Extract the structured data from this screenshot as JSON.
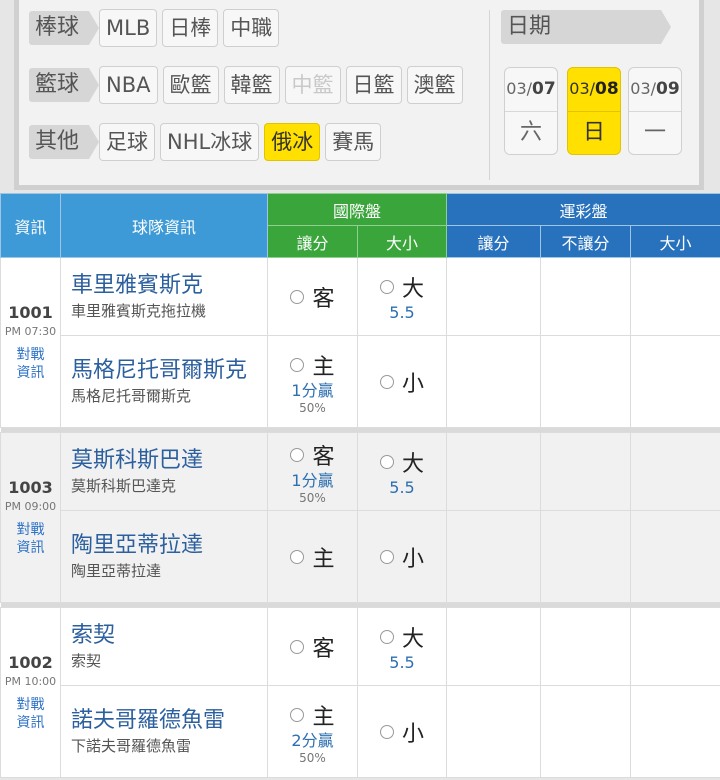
{
  "filters": [
    {
      "label": "棒球",
      "chips": [
        {
          "text": "MLB",
          "state": "normal"
        },
        {
          "text": "日棒",
          "state": "normal"
        },
        {
          "text": "中職",
          "state": "normal"
        }
      ]
    },
    {
      "label": "籃球",
      "chips": [
        {
          "text": "NBA",
          "state": "normal"
        },
        {
          "text": "歐籃",
          "state": "normal"
        },
        {
          "text": "韓籃",
          "state": "normal"
        },
        {
          "text": "中籃",
          "state": "disabled"
        },
        {
          "text": "日籃",
          "state": "normal"
        },
        {
          "text": "澳籃",
          "state": "normal"
        }
      ]
    },
    {
      "label": "其他",
      "chips": [
        {
          "text": "足球",
          "state": "normal"
        },
        {
          "text": "NHL冰球",
          "state": "normal"
        },
        {
          "text": "俄冰",
          "state": "active"
        },
        {
          "text": "賽馬",
          "state": "normal"
        }
      ]
    }
  ],
  "date": {
    "label": "日期",
    "items": [
      {
        "month": "03/",
        "day": "07",
        "weekday": "六",
        "active": false
      },
      {
        "month": "03/",
        "day": "08",
        "weekday": "日",
        "active": true
      },
      {
        "month": "03/",
        "day": "09",
        "weekday": "一",
        "active": false
      }
    ]
  },
  "table": {
    "headers": {
      "info": "資訊",
      "team": "球隊資訊",
      "intl": "國際盤",
      "intl_spread": "讓分",
      "intl_total": "大小",
      "lottery": "運彩盤",
      "lot_spread": "讓分",
      "lot_nospread": "不讓分",
      "lot_total": "大小"
    },
    "games": [
      {
        "no": "1001",
        "time": "PM 07:30",
        "link": [
          "對戰",
          "資訊"
        ],
        "home": {
          "name": "車里雅賓斯克",
          "sub": "車里雅賓斯克拖拉機",
          "spread": "客",
          "spread_line": "",
          "spread_pct": "",
          "total": "大",
          "total_line": "5.5"
        },
        "away": {
          "name": "馬格尼托哥爾斯克",
          "sub": "馬格尼托哥爾斯克",
          "spread": "主",
          "spread_line": "1分贏",
          "spread_pct": "50%",
          "total": "小",
          "total_line": ""
        }
      },
      {
        "no": "1003",
        "time": "PM 09:00",
        "link": [
          "對戰",
          "資訊"
        ],
        "home": {
          "name": "莫斯科斯巴達",
          "sub": "莫斯科斯巴達克",
          "spread": "客",
          "spread_line": "1分贏",
          "spread_pct": "50%",
          "total": "大",
          "total_line": "5.5"
        },
        "away": {
          "name": "陶里亞蒂拉達",
          "sub": "陶里亞蒂拉達",
          "spread": "主",
          "spread_line": "",
          "spread_pct": "",
          "total": "小",
          "total_line": ""
        }
      },
      {
        "no": "1002",
        "time": "PM 10:00",
        "link": [
          "對戰",
          "資訊"
        ],
        "home": {
          "name": "索契",
          "sub": "索契",
          "spread": "客",
          "spread_line": "",
          "spread_pct": "",
          "total": "大",
          "total_line": "5.5"
        },
        "away": {
          "name": "諾夫哥羅德魚雷",
          "sub": "下諾夫哥羅德魚雷",
          "spread": "主",
          "spread_line": "2分贏",
          "spread_pct": "50%",
          "total": "小",
          "total_line": ""
        }
      }
    ]
  }
}
